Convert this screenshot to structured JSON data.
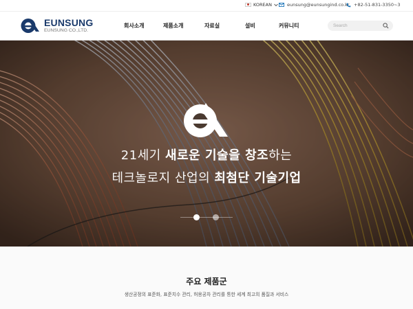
{
  "topbar": {
    "language": "KOREAN",
    "email": "eunsung@eunsungind.co.kr",
    "phone": "+82-51-831-3350~3"
  },
  "header": {
    "brand": "EUNSUNG",
    "brand_sub": "EUNSUNG CO.,LTD.",
    "nav": [
      "회사소개",
      "제품소개",
      "자료실",
      "설비",
      "커뮤니티"
    ],
    "search_placeholder": "Search"
  },
  "hero": {
    "line1_a": "21세기 ",
    "line1_b": "새로운 기술을 창조",
    "line1_c": "하는",
    "line2_a": "테크놀로지 산업의 ",
    "line2_b": "최첨단 기술기업",
    "slides_total": 2,
    "slide_active": 1
  },
  "products": {
    "title": "주요 제품군",
    "subtitle": "생산공정의 표준화, 표준치수 관리, 허용공차 관리를 통한 세계 최고의 품질과 서비스"
  },
  "colors": {
    "brand_blue": "#1a3a6b",
    "accent_blue": "#1a73b8"
  },
  "icons": [
    "flag-kr-icon",
    "chevron-down-icon",
    "mail-icon",
    "phone-icon",
    "search-icon",
    "company-logo-icon"
  ]
}
